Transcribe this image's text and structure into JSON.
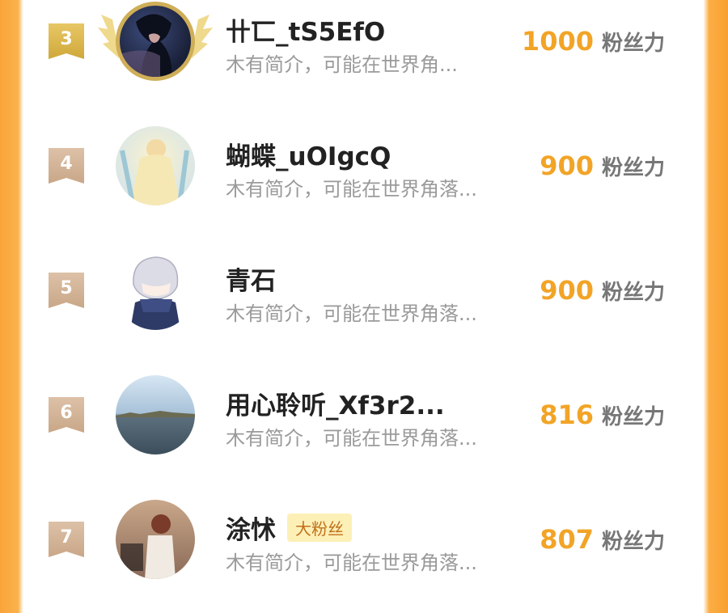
{
  "colors": {
    "accent": "#f2a427",
    "gold_rank": "#d9b44a",
    "tan_rank": "#d3b394",
    "badge_bg": "#fdf0b7"
  },
  "rows": [
    {
      "rank": "3",
      "name": "卄匸_tS5EfO",
      "bio": "木有简介，可能在世界角...",
      "score": "1000",
      "unit": "粉丝力",
      "badge": ""
    },
    {
      "rank": "4",
      "name": "蝴蝶_uOIgcQ",
      "bio": "木有简介，可能在世界角落...",
      "score": "900",
      "unit": "粉丝力",
      "badge": ""
    },
    {
      "rank": "5",
      "name": "青石",
      "bio": "木有简介，可能在世界角落...",
      "score": "900",
      "unit": "粉丝力",
      "badge": ""
    },
    {
      "rank": "6",
      "name": "用心聆听_Xf3r2...",
      "bio": "木有简介，可能在世界角落...",
      "score": "816",
      "unit": "粉丝力",
      "badge": ""
    },
    {
      "rank": "7",
      "name": "涂怵",
      "bio": "木有简介，可能在世界角落...",
      "score": "807",
      "unit": "粉丝力",
      "badge": "大粉丝"
    }
  ]
}
